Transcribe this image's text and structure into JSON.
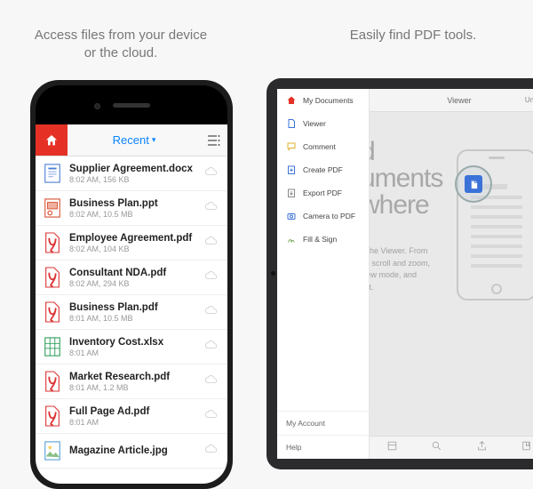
{
  "captions": {
    "left": "Access files from your device or the cloud.",
    "right": "Easily find PDF tools."
  },
  "phone": {
    "header_title": "Recent",
    "files": [
      {
        "name": "Supplier Agreement.docx",
        "time": "8:02 AM",
        "size": "156 KB",
        "type": "docx"
      },
      {
        "name": "Business Plan.ppt",
        "time": "8:02 AM",
        "size": "10.5 MB",
        "type": "ppt"
      },
      {
        "name": "Employee Agreement.pdf",
        "time": "8:02 AM",
        "size": "104 KB",
        "type": "pdf"
      },
      {
        "name": "Consultant NDA.pdf",
        "time": "8:02 AM",
        "size": "294 KB",
        "type": "pdf"
      },
      {
        "name": "Business Plan.pdf",
        "time": "8:01 AM",
        "size": "10.5 MB",
        "type": "pdf"
      },
      {
        "name": "Inventory Cost.xlsx",
        "time": "8:01 AM",
        "size": "",
        "type": "xlsx"
      },
      {
        "name": "Market Research.pdf",
        "time": "8:01 AM",
        "size": "1.2 MB",
        "type": "pdf"
      },
      {
        "name": "Full Page Ad.pdf",
        "time": "8:01 AM",
        "size": "",
        "type": "pdf"
      },
      {
        "name": "Magazine Article.jpg",
        "time": "",
        "size": "",
        "type": "jpg"
      }
    ]
  },
  "tablet": {
    "header_title": "Viewer",
    "header_action": "Undo",
    "sidebar": [
      {
        "label": "My Documents",
        "icon": "home"
      },
      {
        "label": "Viewer",
        "icon": "doc"
      },
      {
        "label": "Comment",
        "icon": "comment"
      },
      {
        "label": "Create PDF",
        "icon": "create"
      },
      {
        "label": "Export PDF",
        "icon": "export"
      },
      {
        "label": "Camera to PDF",
        "icon": "camera"
      },
      {
        "label": "Fill & Sign",
        "icon": "sign"
      }
    ],
    "footer": [
      {
        "label": "My Account"
      },
      {
        "label": "Help"
      }
    ],
    "body": {
      "big1": "d",
      "big2": "uments",
      "big3": "where",
      "desc1": "n the Viewer. From",
      "desc2": "en scroll and zoom,",
      "desc3": "view mode, and",
      "desc4": "ext."
    }
  }
}
